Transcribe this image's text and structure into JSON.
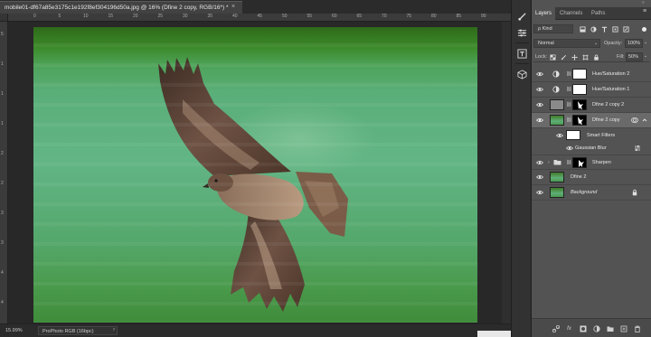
{
  "document": {
    "tab_title": "mobile01-df67a85e3175c1e192f8ef304196d50a.jpg @ 16% (Dfine 2 copy, RGB/16*) *",
    "close_glyph": "×",
    "ruler_top_labels": [
      "0",
      "5",
      "10",
      "15",
      "20",
      "25",
      "30",
      "35",
      "40",
      "45",
      "50",
      "55",
      "60",
      "65",
      "70",
      "75",
      "80",
      "85",
      "90"
    ],
    "ruler_left_labels": [
      "5",
      "1",
      "1",
      "1",
      "2",
      "2",
      "3",
      "3",
      "4",
      "4"
    ]
  },
  "status_bar": {
    "zoom": "15.99%",
    "profile": "ProPhoto RGB (16bpc)",
    "arrow": "›"
  },
  "tools": {
    "icons": [
      "brush-settings-icon",
      "adjustments-icon",
      "character-icon",
      "3d-icon"
    ]
  },
  "layers_panel": {
    "collapse_glyph": "»",
    "tabs": [
      "Layers",
      "Channels",
      "Paths"
    ],
    "menu_glyph": "≡",
    "filter_kind": "ρ Kind",
    "blend_mode": "Normal",
    "blend_arrow": "⌄",
    "opacity_label": "Opacity:",
    "opacity_value": "100%",
    "fill_label": "Fill:",
    "fill_value": "50%",
    "lock_label": "Lock:",
    "value_arrow": "⌄",
    "layers": [
      {
        "name": "Hue/Saturation 2",
        "kind": "adjustment",
        "visible": true
      },
      {
        "name": "Hue/Saturation 1",
        "kind": "adjustment",
        "visible": true
      },
      {
        "name": "Dfine 2 copy 2",
        "kind": "pixel-mask",
        "visible": true
      },
      {
        "name": "Dfine 2 copy",
        "kind": "smart-object",
        "visible": true,
        "selected": true
      },
      {
        "name": "Smart Filters",
        "kind": "smart-filters",
        "visible": true
      },
      {
        "name": "Gaussian Blur",
        "kind": "filter",
        "visible": true
      },
      {
        "name": "Sharpen",
        "kind": "group",
        "visible": true
      },
      {
        "name": "Dfine 2",
        "kind": "pixel",
        "visible": true
      },
      {
        "name": "Background",
        "kind": "background",
        "visible": true,
        "locked": true
      }
    ],
    "bottom_icons": [
      "link-icon",
      "fx-icon",
      "mask-icon",
      "adjustment-icon",
      "folder-icon",
      "new-layer-icon",
      "trash-icon"
    ],
    "fx_label": "fx"
  }
}
